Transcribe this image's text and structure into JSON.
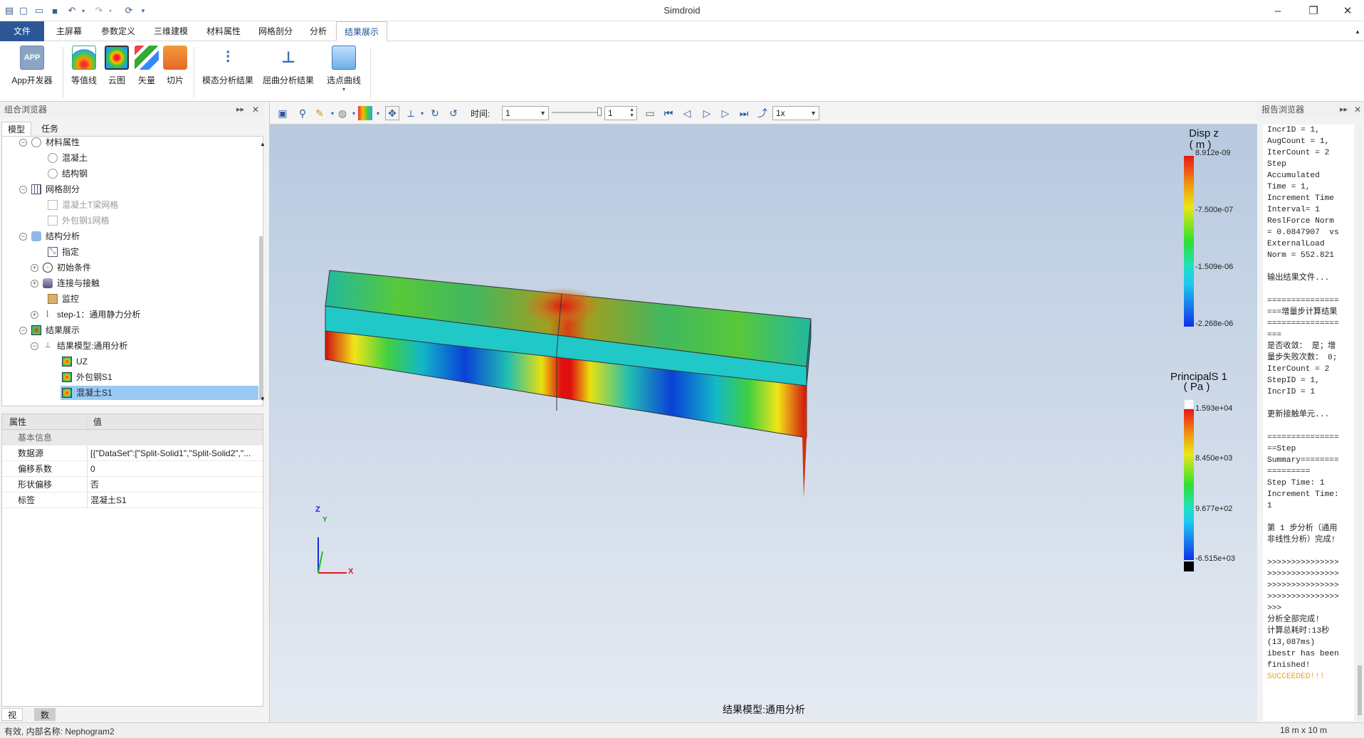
{
  "app": {
    "title": "Simdroid"
  },
  "window_controls": {
    "minimize": "–",
    "maximize": "❐",
    "close": "✕"
  },
  "menu": [
    "文件",
    "主屏幕",
    "参数定义",
    "三维建模",
    "材料属性",
    "网格剖分",
    "分析",
    "结果展示"
  ],
  "ribbon": {
    "buttons": [
      "App开发器",
      "等值线",
      "云图",
      "矢量",
      "切片",
      "模态分析结果",
      "屈曲分析结果",
      "选点曲线"
    ],
    "app_icon_text": "APP"
  },
  "left_panel": {
    "title": "组合浏览器",
    "tabs": [
      "模型",
      "任务"
    ],
    "tree": [
      {
        "label": "材料属性"
      },
      {
        "label": "混凝土"
      },
      {
        "label": "结构钢"
      },
      {
        "label": "网格剖分"
      },
      {
        "label": "混凝土T梁网格"
      },
      {
        "label": "外包钢1网格"
      },
      {
        "label": "结构分析"
      },
      {
        "label": "指定"
      },
      {
        "label": "初始条件"
      },
      {
        "label": "连接与接触"
      },
      {
        "label": "监控"
      },
      {
        "label": "step-1：通用静力分析"
      },
      {
        "label": "结果展示"
      },
      {
        "label": "结果模型:通用分析"
      },
      {
        "label": "UZ"
      },
      {
        "label": "外包钢S1"
      },
      {
        "label": "混凝土S1"
      }
    ],
    "properties": {
      "headers": [
        "属性",
        "值"
      ],
      "group": "基本信息",
      "rows": [
        {
          "name": "数据源",
          "value": "[{\"DataSet\":[\"Split-Solid1\",\"Split-Solid2\",\"..."
        },
        {
          "name": "偏移系数",
          "value": "0"
        },
        {
          "name": "形状偏移",
          "value": "否"
        },
        {
          "name": "标签",
          "value": "混凝土S1"
        }
      ]
    },
    "bottom_tabs": [
      "视图",
      "数据"
    ]
  },
  "viewport": {
    "time_label": "时间:",
    "time_value": "1",
    "frame_value": "1",
    "speed_value": "1x",
    "model_label": "结果模型:通用分析",
    "legend_disp": {
      "title1": "Disp z",
      "title2": "( m )",
      "labels": [
        "8.912e-09",
        "-7.500e-07",
        "-1.509e-06",
        "-2.268e-06"
      ]
    },
    "legend_stress": {
      "title1": "PrincipalS 1",
      "title2": "( Pa )",
      "labels": [
        "1.593e+04",
        "8.450e+03",
        "9.677e+02",
        "-6.515e+03"
      ]
    },
    "axes": {
      "x": "X",
      "y": "Y",
      "z": "Z"
    }
  },
  "right_panel": {
    "title": "报告浏览器",
    "log_lines": [
      "IncrID = 1,",
      "AugCount = 1,",
      "IterCount = 2",
      "Step",
      "Accumulated",
      "Time = 1,",
      "Increment Time",
      "Interval= 1",
      "ReslForce Norm",
      "= 0.0847907  vs",
      "ExternalLoad",
      "Norm = 552.821",
      "",
      "输出结果文件...",
      "",
      "===============",
      "===增量步计算结果",
      "===============",
      "===",
      "是否收敛： 是；增",
      "量步失败次数： 0;",
      "IterCount = 2",
      "StepID = 1,",
      "IncrID = 1",
      "",
      "更新接触单元...",
      "",
      "===============",
      "==Step",
      "Summary========",
      "=========",
      "Step Time: 1",
      "Increment Time:",
      "1",
      "",
      "第 1 步分析（通用",
      "非线性分析）完成!",
      "",
      ">>>>>>>>>>>>>>>",
      ">>>>>>>>>>>>>>>",
      ">>>>>>>>>>>>>>>",
      ">>>>>>>>>>>>>>>",
      ">>>",
      "分析全部完成!",
      "计算总耗时:13秒",
      "(13,087ms)",
      "ibestr has been",
      "finished!"
    ],
    "success_line": "SUCCEEDED!!!"
  },
  "status": {
    "left": "有效, 内部名称: Nephogram2",
    "right": "18 m x 10 m"
  }
}
